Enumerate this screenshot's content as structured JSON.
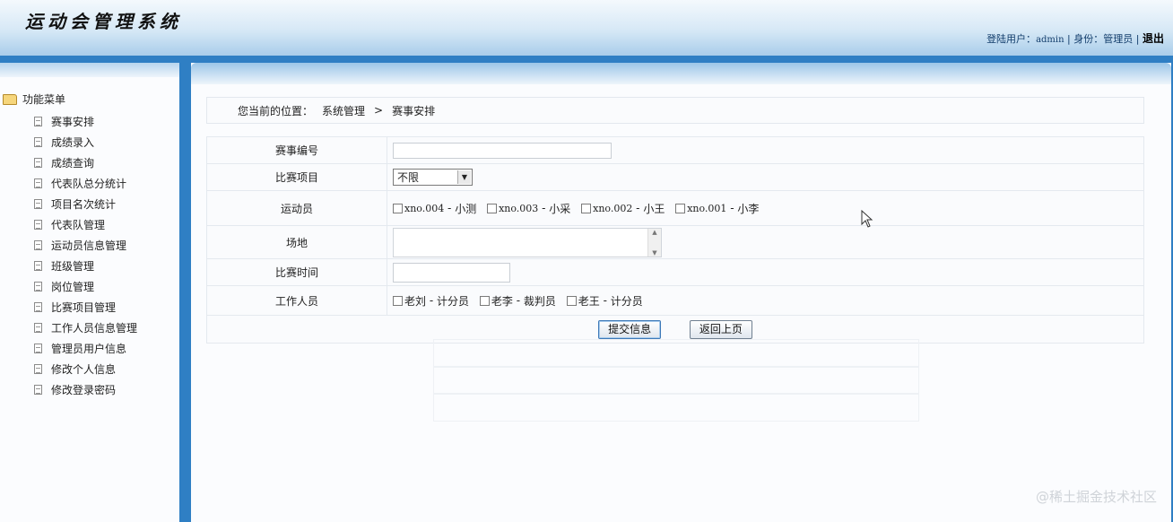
{
  "header": {
    "app_title": "运动会管理系统",
    "login_label": "登陆用户：",
    "username": "admin",
    "separator": "|",
    "role_label": "身份：",
    "role": "管理员",
    "logout": "退出"
  },
  "sidebar": {
    "root_label": "功能菜单",
    "items": [
      {
        "label": "赛事安排",
        "icon": "document-icon"
      },
      {
        "label": "成绩录入",
        "icon": "document-icon"
      },
      {
        "label": "成绩查询",
        "icon": "document-icon"
      },
      {
        "label": "代表队总分统计",
        "icon": "document-icon"
      },
      {
        "label": "项目名次统计",
        "icon": "document-icon"
      },
      {
        "label": "代表队管理",
        "icon": "document-icon"
      },
      {
        "label": "运动员信息管理",
        "icon": "document-icon"
      },
      {
        "label": "班级管理",
        "icon": "document-icon"
      },
      {
        "label": "岗位管理",
        "icon": "document-icon"
      },
      {
        "label": "比赛项目管理",
        "icon": "document-icon"
      },
      {
        "label": "工作人员信息管理",
        "icon": "document-icon"
      },
      {
        "label": "管理员用户信息",
        "icon": "document-icon"
      },
      {
        "label": "修改个人信息",
        "icon": "document-icon"
      },
      {
        "label": "修改登录密码",
        "icon": "document-icon"
      }
    ]
  },
  "breadcrumb": {
    "prefix": "您当前的位置：",
    "section": "系统管理",
    "arrow": ">",
    "page": "赛事安排"
  },
  "form": {
    "event_id": {
      "label": "赛事编号",
      "value": ""
    },
    "event_item": {
      "label": "比赛项目",
      "selected": "不限"
    },
    "athletes": {
      "label": "运动员",
      "options": [
        {
          "code": "xno.004",
          "dash": "-",
          "name": "小测",
          "checked": false
        },
        {
          "code": "xno.003",
          "dash": "-",
          "name": "小采",
          "checked": false
        },
        {
          "code": "xno.002",
          "dash": "-",
          "name": "小王",
          "checked": false
        },
        {
          "code": "xno.001",
          "dash": "-",
          "name": "小李",
          "checked": false
        }
      ]
    },
    "venue": {
      "label": "场地",
      "value": ""
    },
    "match_time": {
      "label": "比赛时间",
      "value": ""
    },
    "staff": {
      "label": "工作人员",
      "options": [
        {
          "name": "老刘",
          "dash": "-",
          "role": "计分员",
          "checked": false
        },
        {
          "name": "老李",
          "dash": "-",
          "role": "裁判员",
          "checked": false
        },
        {
          "name": "老王",
          "dash": "-",
          "role": "计分员",
          "checked": false
        }
      ]
    },
    "submit_label": "提交信息",
    "back_label": "返回上页"
  },
  "watermark": "@稀土掘金技术社区",
  "colors": {
    "accent_blue": "#2f7fc4",
    "header_light": "#d6e8f6",
    "panel_bg": "#fbfcfe"
  }
}
